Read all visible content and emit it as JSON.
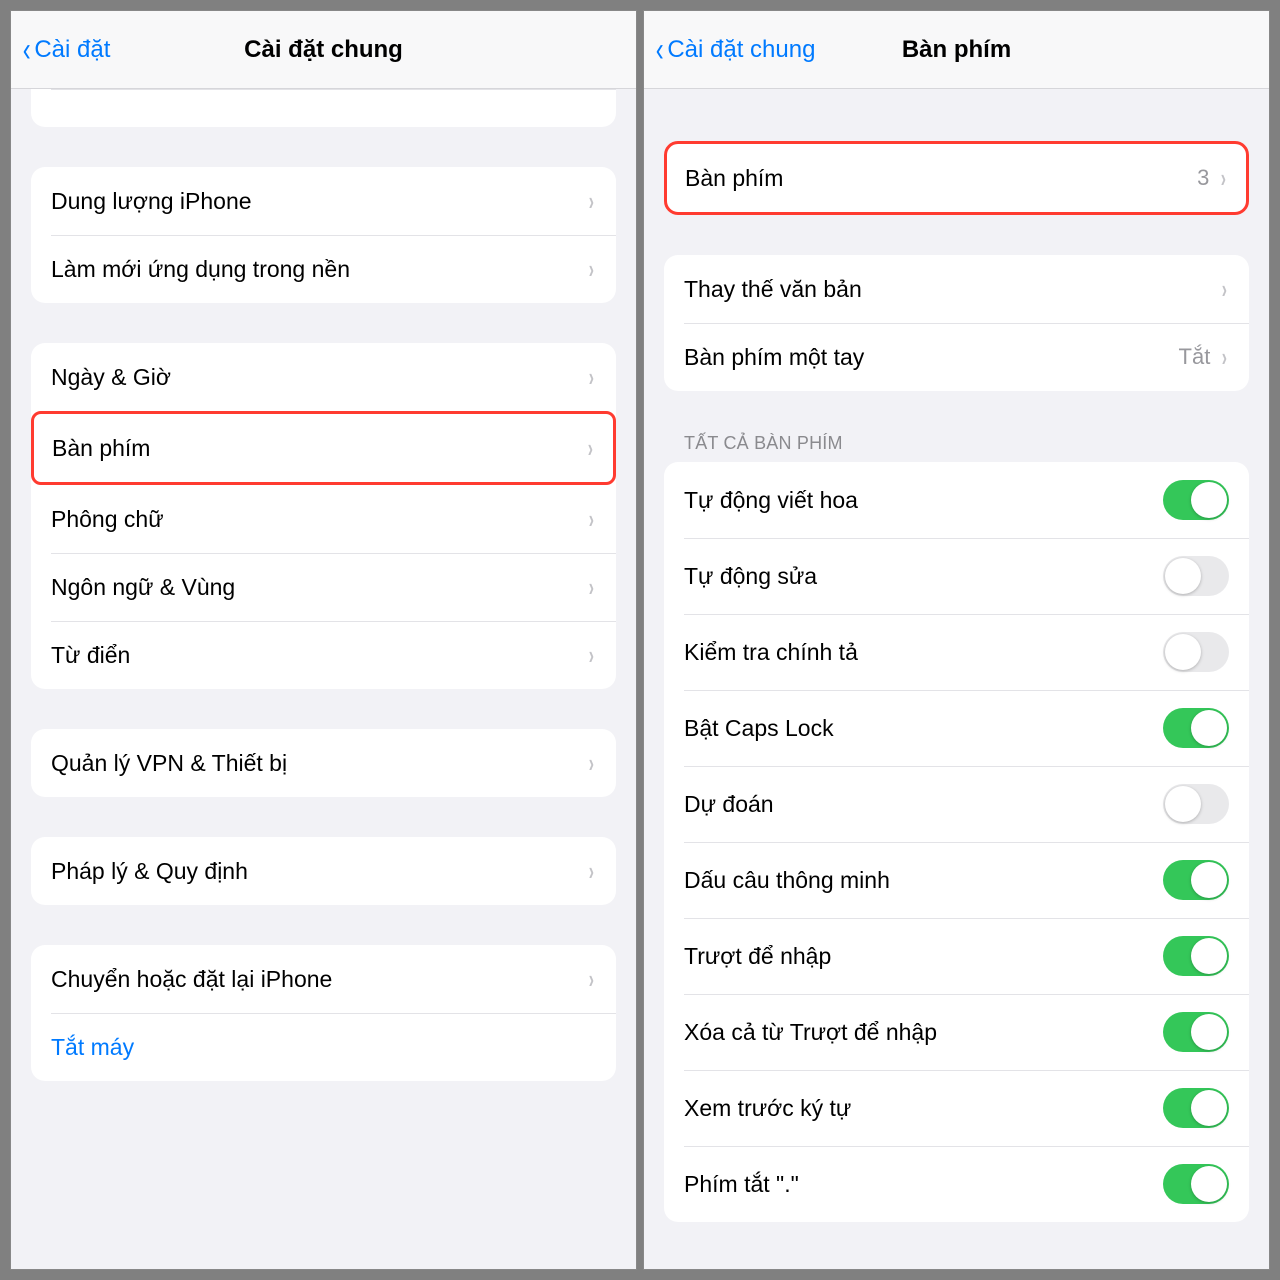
{
  "left": {
    "nav": {
      "back": "Cài đặt",
      "title": "Cài đặt chung"
    },
    "group1": {
      "items": [
        {
          "label": "Dung lượng iPhone"
        },
        {
          "label": "Làm mới ứng dụng trong nền"
        }
      ]
    },
    "group2": {
      "items": [
        {
          "label": "Ngày & Giờ"
        },
        {
          "label": "Bàn phím",
          "highlight": true
        },
        {
          "label": "Phông chữ"
        },
        {
          "label": "Ngôn ngữ & Vùng"
        },
        {
          "label": "Từ điển"
        }
      ]
    },
    "group3": {
      "items": [
        {
          "label": "Quản lý VPN & Thiết bị"
        }
      ]
    },
    "group4": {
      "items": [
        {
          "label": "Pháp lý & Quy định"
        }
      ]
    },
    "group5": {
      "items": [
        {
          "label": "Chuyển hoặc đặt lại iPhone"
        },
        {
          "label": "Tắt máy",
          "blue": true
        }
      ]
    }
  },
  "right": {
    "nav": {
      "back": "Cài đặt chung",
      "title": "Bàn phím"
    },
    "group1": {
      "items": [
        {
          "label": "Bàn phím",
          "value": "3"
        }
      ]
    },
    "group2": {
      "items": [
        {
          "label": "Thay thế văn bản"
        },
        {
          "label": "Bàn phím một tay",
          "value": "Tắt"
        }
      ]
    },
    "section_header": "TẤT CẢ BÀN PHÍM",
    "toggles": [
      {
        "label": "Tự động viết hoa",
        "on": true
      },
      {
        "label": "Tự động sửa",
        "on": false
      },
      {
        "label": "Kiểm tra chính tả",
        "on": false
      },
      {
        "label": "Bật Caps Lock",
        "on": true
      },
      {
        "label": "Dự đoán",
        "on": false
      },
      {
        "label": "Dấu câu thông minh",
        "on": true
      },
      {
        "label": "Trượt để nhập",
        "on": true
      },
      {
        "label": "Xóa cả từ Trượt để nhập",
        "on": true
      },
      {
        "label": "Xem trước ký tự",
        "on": true
      },
      {
        "label": "Phím tắt \".\"",
        "on": true
      }
    ]
  }
}
